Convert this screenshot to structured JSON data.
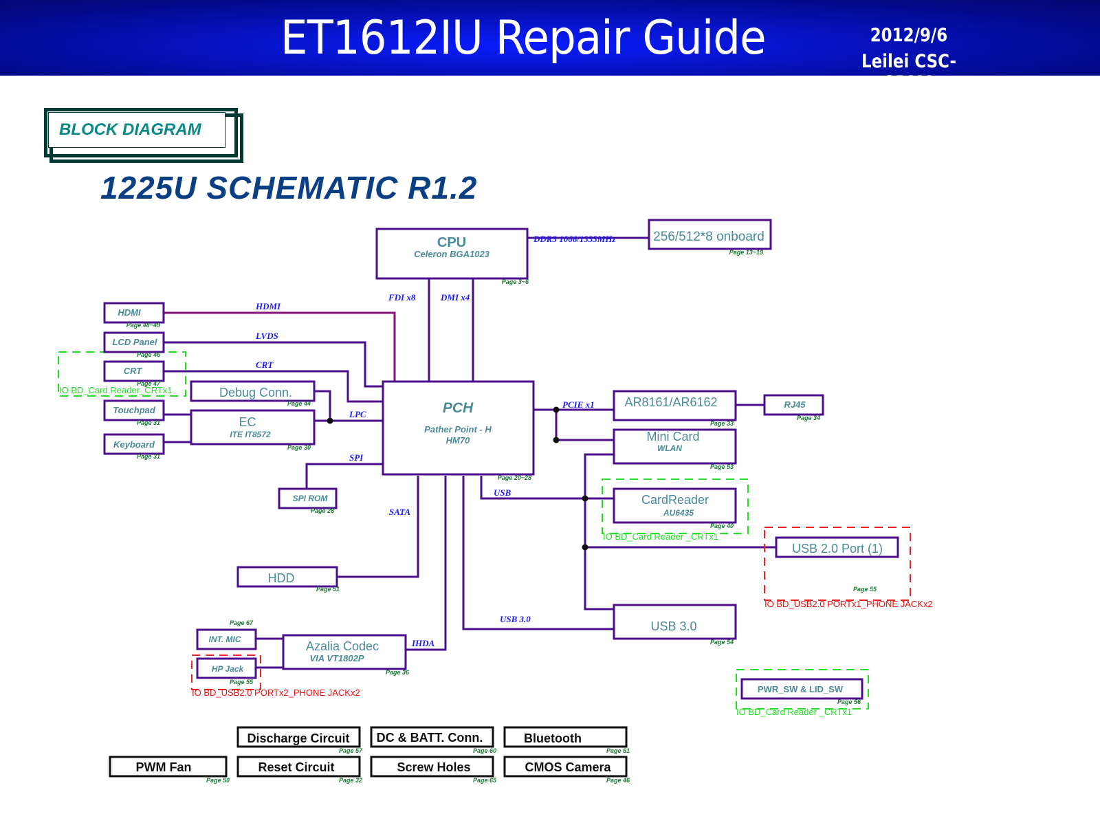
{
  "header": {
    "title": "ET1612IU Repair Guide",
    "date": "2012/9/6",
    "author": "Leilei CSC-GRMA"
  },
  "section_label": "BLOCK DIAGRAM",
  "schematic_title": "1225U SCHEMATIC R1.2",
  "blocks": {
    "cpu": {
      "title": "CPU",
      "subtitle": "Celeron BGA1023",
      "page": "Page 3~6"
    },
    "memory": {
      "title": "256/512*8 onboard",
      "page": "Page 13~19"
    },
    "pch": {
      "title": "PCH",
      "subtitle": "Pather Point - H",
      "subtitle2": "HM70",
      "page": "Page 20~28"
    },
    "hdmi": {
      "title": "HDMI",
      "page": "Page 48~49"
    },
    "lcd": {
      "title": "LCD Panel",
      "page": "Page 46"
    },
    "crt": {
      "title": "CRT",
      "page": "Page 47"
    },
    "debug": {
      "title": "Debug Conn.",
      "page": "Page 44"
    },
    "touchpad": {
      "title": "Touchpad",
      "page": "Page 31"
    },
    "keyboard": {
      "title": "Keyboard",
      "page": "Page 31"
    },
    "ec": {
      "title": "EC",
      "subtitle": "ITE IT8572",
      "page": "Page 30"
    },
    "spirom": {
      "title": "SPI ROM",
      "page": "Page 28"
    },
    "hdd": {
      "title": "HDD",
      "page": "Page 51"
    },
    "intmic": {
      "title": "INT. MIC",
      "page": "Page 67"
    },
    "hpjack": {
      "title": "HP Jack",
      "page": "Page 55"
    },
    "codec": {
      "title": "Azalia Codec",
      "subtitle": "VIA VT1802P",
      "page": "Page 36"
    },
    "lan": {
      "title": "AR8161/AR6162",
      "page": "Page 33"
    },
    "rj45": {
      "title": "RJ45",
      "page": "Page 34"
    },
    "minicard": {
      "title": "Mini Card",
      "subtitle": "WLAN",
      "page": "Page 53"
    },
    "cardreader": {
      "title": "CardReader",
      "subtitle": "AU6435",
      "page": "Page 40"
    },
    "usb2": {
      "title": "USB 2.0 Port (1)",
      "page": "Page 55"
    },
    "usb3": {
      "title": "USB 3.0",
      "page": "Page 54"
    },
    "pwrsw": {
      "title": "PWR_SW & LID_SW",
      "page": "Page 56"
    }
  },
  "buses": {
    "ddr3": "DDR3 1066/1333MHz",
    "fdi": "FDI x8",
    "dmi": "DMI x4",
    "hdmi": "HDMI",
    "lvds": "LVDS",
    "crt": "CRT",
    "lpc": "LPC",
    "spi": "SPI",
    "pcie": "PCIE x1",
    "usb": "USB",
    "sata": "SATA",
    "usb30": "USB 3.0",
    "ihda": "IHDA"
  },
  "groups": {
    "crt_group": "IO BD_Card Reader_CRTx1",
    "cardreader_group": "IO BD_Card Reader _CRTx1",
    "usb2_group": "IO BD_USB2.0 PORTx1_PHONE JACKx2",
    "hpjack_group": "IO BD_USB2.0 PORTx2_PHONE JACKx2",
    "pwrsw_group": "IO BD_Card Reader _CRTx1"
  },
  "misc_blocks": [
    {
      "title": "Discharge Circuit",
      "page": "Page 57"
    },
    {
      "title": "DC & BATT. Conn.",
      "page": "Page 60"
    },
    {
      "title": "Bluetooth",
      "page": "Page 61"
    },
    {
      "title": "PWM Fan",
      "page": "Page 50"
    },
    {
      "title": "Reset Circuit",
      "page": "Page 32"
    },
    {
      "title": "Screw Holes",
      "page": "Page 65"
    },
    {
      "title": "CMOS Camera",
      "page": "Page 46"
    }
  ],
  "colors": {
    "header_bg": "#0614c8",
    "box_stroke": "#4b0e8c",
    "box_text": "#4a8a99",
    "bus_label": "#1a1aff",
    "page_label": "#1a7a34",
    "green_group": "#22e022",
    "red_group": "#ee2222"
  }
}
